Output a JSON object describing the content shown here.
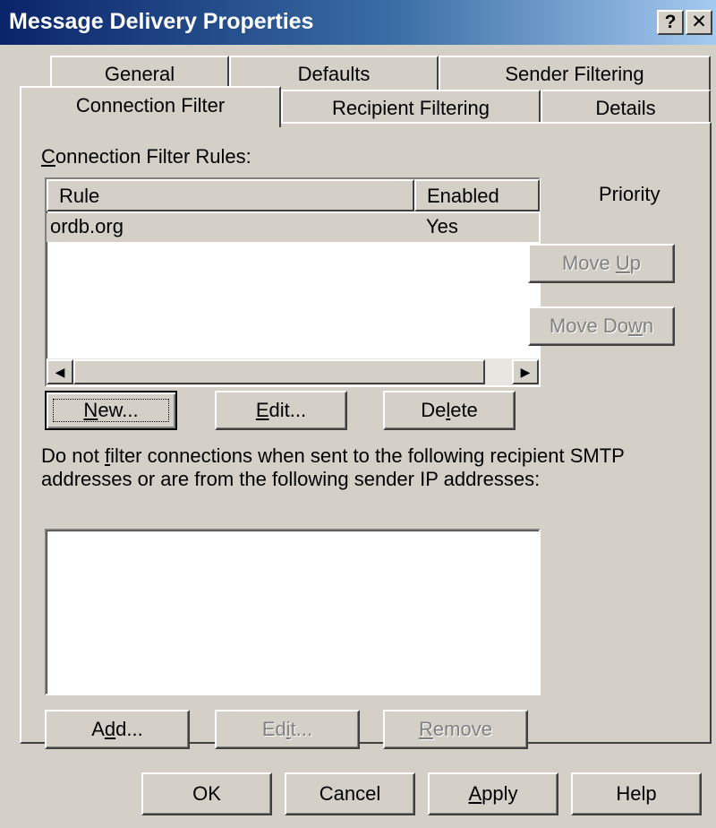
{
  "window": {
    "title": "Message Delivery Properties",
    "help_glyph": "?",
    "close_glyph": "✕"
  },
  "tabs": {
    "back_row": [
      "General",
      "Defaults",
      "Sender Filtering"
    ],
    "front_row": [
      "Connection Filter",
      "Recipient Filtering",
      "Details"
    ],
    "active": "Connection Filter"
  },
  "rules": {
    "label_accel": "C",
    "label_rest": "onnection Filter Rules:",
    "columns": [
      "Rule",
      "Enabled"
    ],
    "rows": [
      {
        "rule": "ordb.org",
        "enabled": "Yes"
      }
    ],
    "scroll_left": "◀",
    "scroll_right": "▶"
  },
  "priority": {
    "label": "Priority",
    "move_up_pre": "Move ",
    "move_up_accel": "U",
    "move_up_post": "p",
    "move_down_pre": "Move Do",
    "move_down_accel": "w",
    "move_down_post": "n"
  },
  "rule_buttons": {
    "new_accel": "N",
    "new_rest": "ew...",
    "edit_accel": "E",
    "edit_rest": "dit...",
    "delete_pre": "De",
    "delete_accel": "l",
    "delete_post": "ete"
  },
  "exceptions": {
    "desc_pre": "Do not ",
    "desc_accel": "f",
    "desc_line1_rest": "ilter connections when sent to the following recipient SMTP",
    "desc_line2": "addresses or are from the following sender IP addresses:",
    "add_pre": "A",
    "add_accel": "d",
    "add_post": "d...",
    "edit_pre": "Ed",
    "edit_accel": "i",
    "edit_post": "t...",
    "remove_accel": "R",
    "remove_rest": "emove"
  },
  "dialog_buttons": {
    "ok": "OK",
    "cancel": "Cancel",
    "apply_accel": "A",
    "apply_rest": "pply",
    "help": "Help"
  }
}
